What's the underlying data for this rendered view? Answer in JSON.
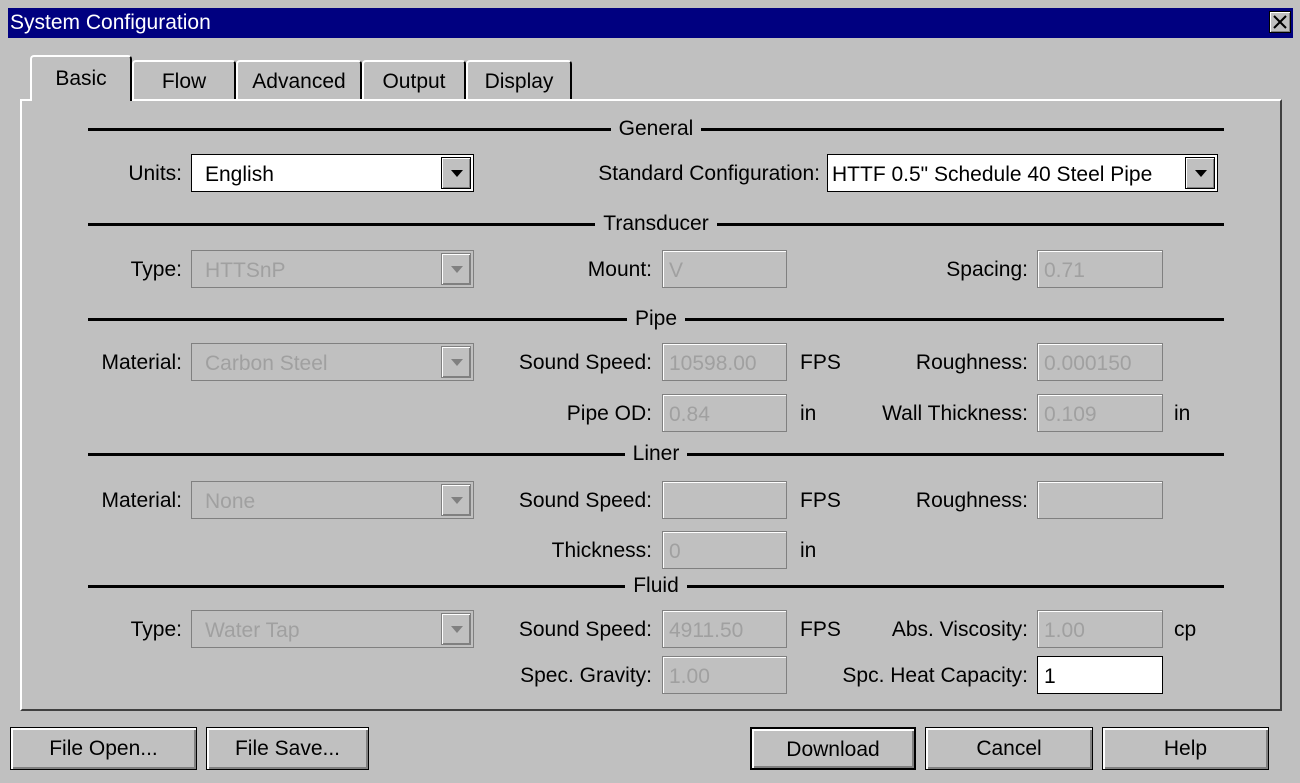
{
  "window": {
    "title": "System Configuration"
  },
  "tabs": [
    {
      "label": "Basic",
      "active": true
    },
    {
      "label": "Flow",
      "active": false
    },
    {
      "label": "Advanced",
      "active": false
    },
    {
      "label": "Output",
      "active": false
    },
    {
      "label": "Display",
      "active": false
    }
  ],
  "general": {
    "heading": "General",
    "units_label": "Units:",
    "units_value": "English",
    "std_config_label": "Standard Configuration:",
    "std_config_value": "HTTF 0.5\" Schedule 40 Steel Pipe"
  },
  "transducer": {
    "heading": "Transducer",
    "type_label": "Type:",
    "type_value": "HTTSnP",
    "mount_label": "Mount:",
    "mount_value": "V",
    "spacing_label": "Spacing:",
    "spacing_value": "0.71"
  },
  "pipe": {
    "heading": "Pipe",
    "material_label": "Material:",
    "material_value": "Carbon Steel",
    "sound_speed_label": "Sound Speed:",
    "sound_speed_value": "10598.00",
    "sound_speed_unit": "FPS",
    "roughness_label": "Roughness:",
    "roughness_value": "0.000150",
    "od_label": "Pipe OD:",
    "od_value": "0.84",
    "od_unit": "in",
    "wall_label": "Wall Thickness:",
    "wall_value": "0.109",
    "wall_unit": "in"
  },
  "liner": {
    "heading": "Liner",
    "material_label": "Material:",
    "material_value": "None",
    "sound_speed_label": "Sound Speed:",
    "sound_speed_value": "",
    "sound_speed_unit": "FPS",
    "roughness_label": "Roughness:",
    "roughness_value": "",
    "thickness_label": "Thickness:",
    "thickness_value": "0",
    "thickness_unit": "in"
  },
  "fluid": {
    "heading": "Fluid",
    "type_label": "Type:",
    "type_value": "Water Tap",
    "sound_speed_label": "Sound Speed:",
    "sound_speed_value": "4911.50",
    "sound_speed_unit": "FPS",
    "viscosity_label": "Abs. Viscosity:",
    "viscosity_value": "1.00",
    "viscosity_unit": "cp",
    "gravity_label": "Spec. Gravity:",
    "gravity_value": "1.00",
    "heat_label": "Spc. Heat Capacity:",
    "heat_value": "1"
  },
  "buttons": {
    "file_open": "File Open...",
    "file_save": "File Save...",
    "download": "Download",
    "cancel": "Cancel",
    "help": "Help"
  },
  "colors": {
    "titlebar": "#000080",
    "face": "#c0c0c0",
    "disabled_text": "#a0a0a0"
  }
}
